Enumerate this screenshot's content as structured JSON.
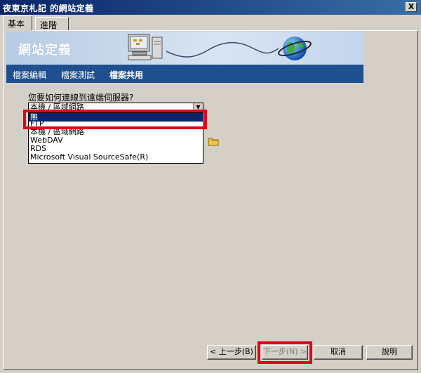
{
  "window": {
    "title": "夜東京札記 的網站定義",
    "close_label": "X"
  },
  "tabs": [
    {
      "label": "基本",
      "active": true
    },
    {
      "label": "進階",
      "active": false
    }
  ],
  "banner": {
    "title": "網站定義"
  },
  "nav": [
    {
      "label": "檔案編輯"
    },
    {
      "label": "檔案測試"
    },
    {
      "label": "檔案共用",
      "active": true
    }
  ],
  "form": {
    "question": "您要如何連線到遠端伺服器?",
    "select_value": "本機 / 區域網路",
    "options": [
      {
        "label": "無",
        "selected": true
      },
      {
        "label": "FTP",
        "selected": false
      },
      {
        "label": "本機 / 區域網路",
        "selected": false
      },
      {
        "label": "WebDAV",
        "selected": false
      },
      {
        "label": "RDS",
        "selected": false
      },
      {
        "label": "Microsoft Visual SourceSafe(R)",
        "selected": false
      }
    ]
  },
  "buttons": {
    "prev": "< 上一步(B)",
    "next": "下一步(N) >",
    "cancel": "取消",
    "help": "說明"
  },
  "colors": {
    "titlebar": "#0a246a",
    "navbar": "#1f4f8f",
    "highlight": "#e0001a",
    "selection": "#0a246a"
  }
}
